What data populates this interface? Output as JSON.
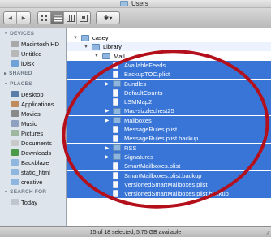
{
  "window": {
    "title": "Users"
  },
  "toolbar": {
    "back_glyph": "◀",
    "forward_glyph": "▶",
    "action_glyph": "✱▾"
  },
  "sidebar": {
    "sections": [
      {
        "title": "DEVICES",
        "items": [
          "Macintosh HD",
          "Untitled",
          "iDisk"
        ]
      },
      {
        "title": "SHARED",
        "items": []
      },
      {
        "title": "PLACES",
        "items": [
          "Desktop",
          "Applications",
          "Movies",
          "Music",
          "Pictures",
          "Documents",
          "Downloads",
          "Backblaze",
          "static_html",
          "creative"
        ]
      },
      {
        "title": "SEARCH FOR",
        "items": [
          "Today"
        ]
      }
    ]
  },
  "list": {
    "rows": [
      {
        "label": "casey",
        "indent": 0,
        "kind": "folder",
        "expanded": true,
        "selected": false
      },
      {
        "label": "Library",
        "indent": 1,
        "kind": "folder",
        "expanded": true,
        "selected": false
      },
      {
        "label": "Mail",
        "indent": 2,
        "kind": "folder",
        "expanded": true,
        "selected": false
      },
      {
        "label": "AvailableFeeds",
        "indent": 3,
        "kind": "file",
        "expanded": null,
        "selected": true
      },
      {
        "label": "BackupTOC.plist",
        "indent": 3,
        "kind": "file",
        "expanded": null,
        "selected": true
      },
      {
        "label": "Bundles",
        "indent": 3,
        "kind": "folder",
        "expanded": false,
        "selected": true
      },
      {
        "label": "DefaultCounts",
        "indent": 3,
        "kind": "file",
        "expanded": null,
        "selected": true
      },
      {
        "label": "LSMMap2",
        "indent": 3,
        "kind": "file",
        "expanded": null,
        "selected": true
      },
      {
        "label": "Mac-sizzlechest25",
        "indent": 3,
        "kind": "folder",
        "expanded": false,
        "selected": true
      },
      {
        "label": "Mailboxes",
        "indent": 3,
        "kind": "folder",
        "expanded": false,
        "selected": true
      },
      {
        "label": "MessageRules.plist",
        "indent": 3,
        "kind": "file",
        "expanded": null,
        "selected": true
      },
      {
        "label": "MessageRules.plist.backup",
        "indent": 3,
        "kind": "file",
        "expanded": null,
        "selected": true
      },
      {
        "label": "RSS",
        "indent": 3,
        "kind": "folder",
        "expanded": false,
        "selected": true
      },
      {
        "label": "Signatures",
        "indent": 3,
        "kind": "folder",
        "expanded": false,
        "selected": true
      },
      {
        "label": "SmartMailboxes.plist",
        "indent": 3,
        "kind": "file",
        "expanded": null,
        "selected": true
      },
      {
        "label": "SmartMailboxes.plist.backup",
        "indent": 3,
        "kind": "file",
        "expanded": null,
        "selected": true
      },
      {
        "label": "VersionedSmartMailboxes.plist",
        "indent": 3,
        "kind": "file",
        "expanded": null,
        "selected": true
      },
      {
        "label": "VersionedSmartMailboxes.plist.backup",
        "indent": 3,
        "kind": "file",
        "expanded": null,
        "selected": true
      }
    ]
  },
  "status": {
    "text": "15 of 18 selected, 5.75 GB available"
  },
  "colors": {
    "selection": "#3875d7",
    "annotation": "#b3101c",
    "sidebar_bg": "#dde4ec"
  }
}
